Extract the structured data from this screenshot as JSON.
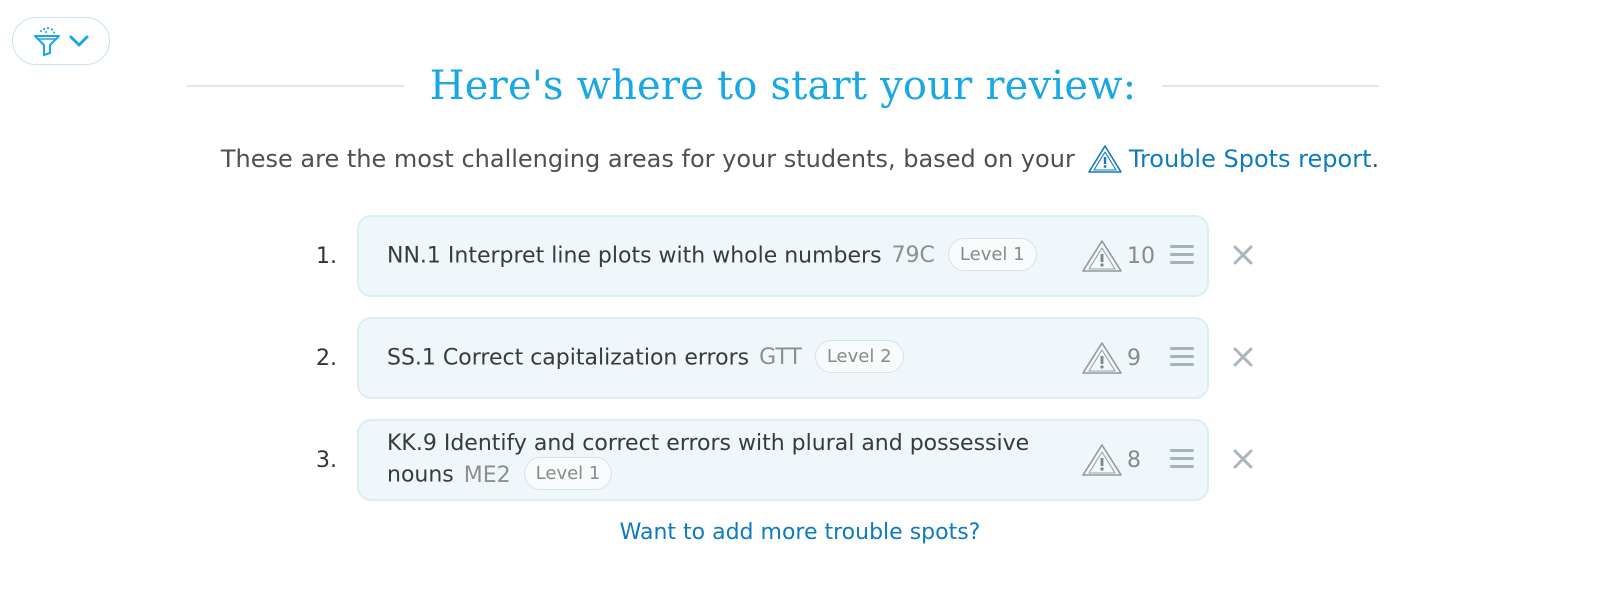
{
  "filter": {
    "icon": "funnel-icon",
    "chevron": "chevron-down-icon"
  },
  "heading": "Here's where to start your review:",
  "intro": {
    "text": "These are the most challenging areas for your students, based on your",
    "link_label": "Trouble Spots report",
    "suffix": "."
  },
  "skills": [
    {
      "num": "1.",
      "name": "NN.1 Interpret line plots with whole numbers",
      "code": "79C",
      "level": "Level 1",
      "count": "10"
    },
    {
      "num": "2.",
      "name": "SS.1 Correct capitalization errors",
      "code": "GTT",
      "level": "Level 2",
      "count": "9"
    },
    {
      "num": "3.",
      "name": "KK.9 Identify and correct errors with plural and possessive nouns",
      "code": "ME2",
      "level": "Level 1",
      "count": "8"
    }
  ],
  "more_link": "Want to add more trouble spots?",
  "colors": {
    "accent": "#1aa7e6",
    "link": "#0e7bc0",
    "card_bg": "#eff7fa"
  }
}
